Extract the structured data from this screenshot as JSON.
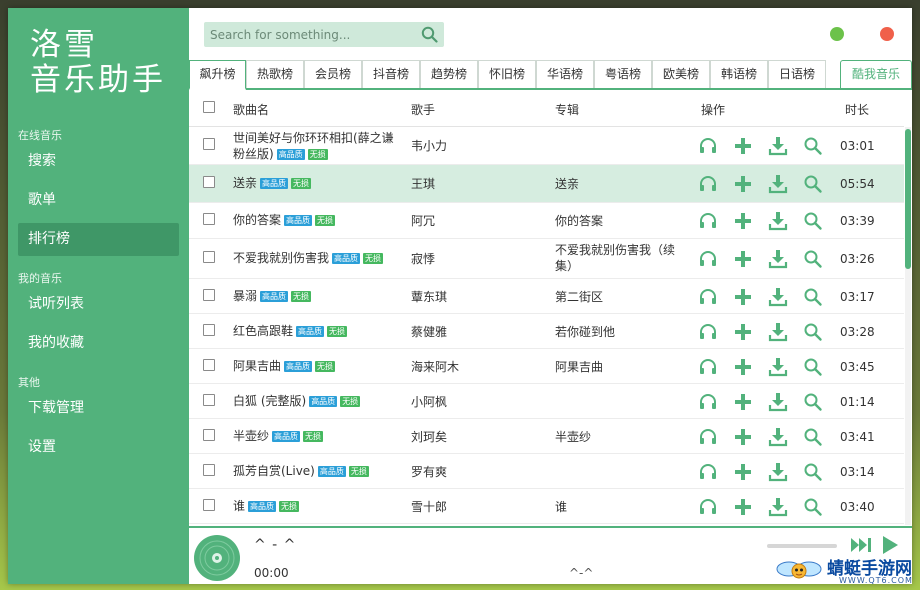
{
  "app": {
    "logo_line1": "洛雪",
    "logo_line2": "音乐助手"
  },
  "sidebar": {
    "sections": [
      {
        "title": "在线音乐",
        "items": [
          "搜索",
          "歌单",
          "排行榜"
        ]
      },
      {
        "title": "我的音乐",
        "items": [
          "试听列表",
          "我的收藏"
        ]
      },
      {
        "title": "其他",
        "items": [
          "下载管理",
          "设置"
        ]
      }
    ],
    "active": "排行榜"
  },
  "search": {
    "placeholder": "Search for something..."
  },
  "window_buttons": {
    "min_color": "#6cc24a",
    "close_color": "#f0604a"
  },
  "tabs": [
    "飙升榜",
    "热歌榜",
    "会员榜",
    "抖音榜",
    "趋势榜",
    "怀旧榜",
    "华语榜",
    "粤语榜",
    "欧美榜",
    "韩语榜",
    "日语榜"
  ],
  "active_tab": "飙升榜",
  "right_tab": "酷我音乐",
  "table": {
    "headers": {
      "name": "歌曲名",
      "artist": "歌手",
      "album": "专辑",
      "ops": "操作",
      "duration": "时长"
    },
    "badge_hq": "高品质",
    "badge_ls": "无损",
    "rows": [
      {
        "name1": "世间美好与你环环相扣(薛之谦",
        "name2": "粉丝版)",
        "artist": "韦小力",
        "album": "",
        "album2": "",
        "duration": "03:01"
      },
      {
        "name1": "送亲",
        "name2": "",
        "artist": "王琪",
        "album": "送亲",
        "album2": "",
        "duration": "05:54"
      },
      {
        "name1": "你的答案",
        "name2": "",
        "artist": "阿冗",
        "album": "你的答案",
        "album2": "",
        "duration": "03:39"
      },
      {
        "name1": "不爱我就别伤害我",
        "name2": "",
        "artist": "寂悸",
        "album": "不爱我就别伤害我（续",
        "album2": "集）",
        "duration": "03:26"
      },
      {
        "name1": "暴溺",
        "name2": "",
        "artist": "蕈东琪",
        "album": "第二街区",
        "album2": "",
        "duration": "03:17"
      },
      {
        "name1": "红色高跟鞋",
        "name2": "",
        "artist": "蔡健雅",
        "album": "若你碰到他",
        "album2": "",
        "duration": "03:28"
      },
      {
        "name1": "阿果吉曲",
        "name2": "",
        "artist": "海来阿木",
        "album": "阿果吉曲",
        "album2": "",
        "duration": "03:45"
      },
      {
        "name1": "白狐 (完整版)",
        "name2": "",
        "artist": "小阿枫",
        "album": "",
        "album2": "",
        "duration": "01:14"
      },
      {
        "name1": "半壶纱",
        "name2": "",
        "artist": "刘珂矣",
        "album": "半壶纱",
        "album2": "",
        "duration": "03:41"
      },
      {
        "name1": "孤芳自赏(Live)",
        "name2": "",
        "artist": "罗有爽",
        "album": "",
        "album2": "",
        "duration": "03:14"
      },
      {
        "name1": "谁",
        "name2": "",
        "artist": "雪十郎",
        "album": "谁",
        "album2": "",
        "duration": "03:40"
      }
    ]
  },
  "player": {
    "title": "^ - ^",
    "time": "00:00",
    "center": "^-^",
    "accent": "#52b27c"
  },
  "watermark": {
    "text": "蜻蜓手游网",
    "url": "WWW.QT6.COM"
  }
}
